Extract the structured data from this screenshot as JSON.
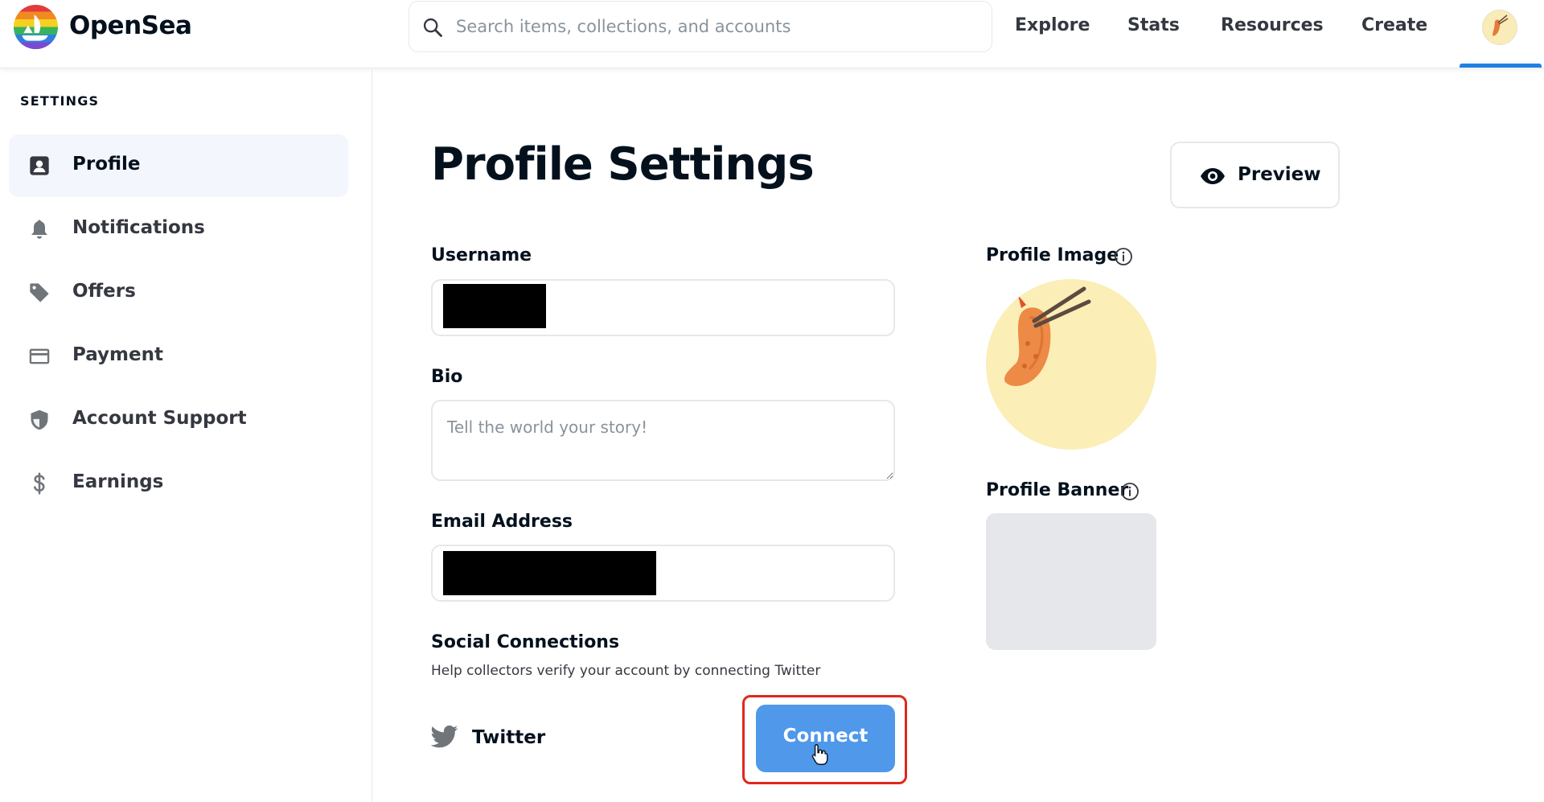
{
  "header": {
    "brand": "OpenSea",
    "search_placeholder": "Search items, collections, and accounts",
    "nav": [
      "Explore",
      "Stats",
      "Resources",
      "Create"
    ],
    "accent_color": "#2081e2"
  },
  "sidebar": {
    "title": "SETTINGS",
    "items": [
      {
        "label": "Profile",
        "icon": "profile-icon",
        "active": true
      },
      {
        "label": "Notifications",
        "icon": "bell-icon",
        "active": false
      },
      {
        "label": "Offers",
        "icon": "tag-icon",
        "active": false
      },
      {
        "label": "Payment",
        "icon": "credit-card-icon",
        "active": false
      },
      {
        "label": "Account Support",
        "icon": "shield-icon",
        "active": false
      },
      {
        "label": "Earnings",
        "icon": "dollar-icon",
        "active": false
      }
    ]
  },
  "main": {
    "title": "Profile Settings",
    "preview_label": "Preview",
    "username_label": "Username",
    "bio_label": "Bio",
    "bio_placeholder": "Tell the world your story!",
    "email_label": "Email Address",
    "social_title": "Social Connections",
    "social_help": "Help collectors verify your account by connecting Twitter",
    "twitter_label": "Twitter",
    "connect_label": "Connect",
    "connect_color": "#4f98ea",
    "highlight_color": "#e0281d"
  },
  "side_panel": {
    "profile_image_label": "Profile Image",
    "profile_banner_label": "Profile Banner"
  }
}
